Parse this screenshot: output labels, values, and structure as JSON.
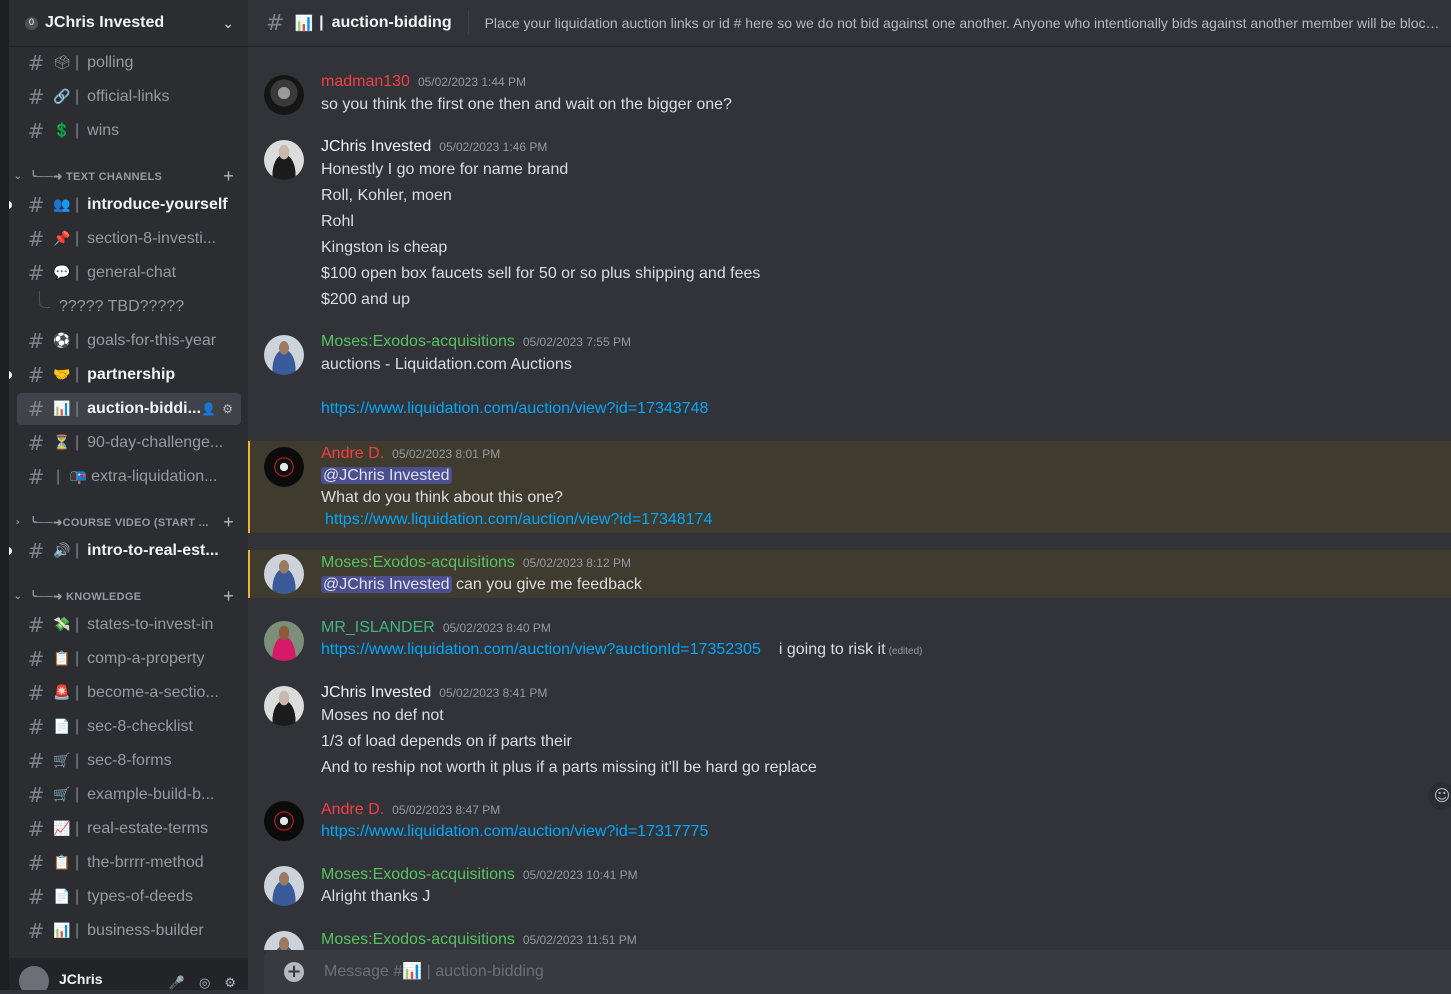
{
  "server": {
    "name": "JChris Invested",
    "badge": "0",
    "chevron": "⌄"
  },
  "channels_top": [
    {
      "emoji": "🗳",
      "label": "polling"
    },
    {
      "emoji": "🔗",
      "label": "official-links"
    },
    {
      "emoji": "💲",
      "label": "wins"
    }
  ],
  "cat_text": {
    "label": "╰──➜ TEXT CHANNELS"
  },
  "channels_text": [
    {
      "emoji": "👥",
      "label": "introduce-yourself"
    },
    {
      "emoji": "📌",
      "label": "section-8-investi..."
    },
    {
      "emoji": "💬",
      "label": "general-chat"
    },
    {
      "emoji": "",
      "label": "????? TBD?????"
    },
    {
      "emoji": "⚽",
      "label": "goals-for-this-year"
    },
    {
      "emoji": "🤝",
      "label": "partnership"
    },
    {
      "emoji": "📊",
      "label": "auction-biddi..."
    },
    {
      "emoji": "⏳",
      "label": "90-day-challenge..."
    },
    {
      "emoji": "📭",
      "label": "extra-liquidation..."
    }
  ],
  "cat_course": {
    "label": "╰──➜COURSE VIDEO (START ..."
  },
  "channels_course": [
    {
      "emoji": "🔊",
      "label": "intro-to-real-est..."
    }
  ],
  "cat_knowledge": {
    "label": "╰──➜ KNOWLEDGE"
  },
  "channels_knowledge": [
    {
      "emoji": "💸",
      "label": "states-to-invest-in"
    },
    {
      "emoji": "📋",
      "label": "comp-a-property"
    },
    {
      "emoji": "🚨",
      "label": "become-a-sectio..."
    },
    {
      "emoji": "📄",
      "label": "sec-8-checklist"
    },
    {
      "emoji": "🛒",
      "label": "sec-8-forms"
    },
    {
      "emoji": "🛒",
      "label": "example-build-b..."
    },
    {
      "emoji": "📈",
      "label": "real-estate-terms"
    },
    {
      "emoji": "📋",
      "label": "the-brrrr-method"
    },
    {
      "emoji": "📄",
      "label": "types-of-deeds"
    },
    {
      "emoji": "📊",
      "label": "business-builder"
    }
  ],
  "user": {
    "name": "JChris"
  },
  "header": {
    "hash": "#",
    "emoji": "📊",
    "title": "auction-bidding",
    "topic": "Place your liquidation auction links or id # here so we do not bid against one another. Anyone who intentionally bids against another member will be blocked fro..."
  },
  "messages": [
    {
      "author": "madman130",
      "time": "05/02/2023 1:44 PM",
      "lines": [
        "so you think the first one then and wait on the bigger one?"
      ]
    },
    {
      "author": "JChris Invested",
      "time": "05/02/2023 1:46 PM",
      "lines": [
        "Honestly I go more for name brand",
        "Roll, Kohler, moen",
        "Rohl",
        "Kingston is cheap",
        "$100 open box faucets sell for 50 or so plus shipping and fees",
        "$200 and up"
      ]
    },
    {
      "author": "Moses:Exodos-acquisitions",
      "time": "05/02/2023 7:55 PM",
      "lines": [
        "auctions - Liquidation.com Auctions",
        "https://www.liquidation.com/auction/view?id=17343748"
      ]
    },
    {
      "author": "Andre D.",
      "time": "05/02/2023 8:01 PM",
      "mention": "@JChris Invested",
      "lines": [
        "What do you think about this one?",
        "https://www.liquidation.com/auction/view?id=17348174"
      ]
    },
    {
      "author": "Moses:Exodos-acquisitions",
      "time": "05/02/2023 8:12 PM",
      "mention": "@JChris Invested",
      "lines": [
        "can you give me feedback"
      ]
    },
    {
      "author": "MR_ISLANDER",
      "time": "05/02/2023 8:40 PM",
      "link": "https://www.liquidation.com/auction/view?auctionId=17352305",
      "lines": [
        "i going to risk it"
      ],
      "edited": "(edited)"
    },
    {
      "author": "JChris Invested",
      "time": "05/02/2023 8:41 PM",
      "lines": [
        "Moses no def not",
        "1/3 of load depends on if parts their",
        "And to reship not worth it plus if a parts missing it'll be hard go replace"
      ]
    },
    {
      "author": "Andre D.",
      "time": "05/02/2023 8:47 PM",
      "lines": [
        "https://www.liquidation.com/auction/view?id=17317775"
      ]
    },
    {
      "author": "Moses:Exodos-acquisitions",
      "time": "05/02/2023 10:41 PM",
      "lines": [
        "Alright thanks J"
      ]
    },
    {
      "author": "Moses:Exodos-acquisitions",
      "time": "05/02/2023 11:51 PM",
      "lines": []
    }
  ],
  "composer": {
    "placeholder": "Message #📊 | auction-bidding"
  },
  "colors": {
    "background": "#313338",
    "sidebar": "#2b2d31",
    "link": "#00a8fc",
    "mention_bg": "#3f3b2f",
    "mention_border": "#f0b232"
  }
}
